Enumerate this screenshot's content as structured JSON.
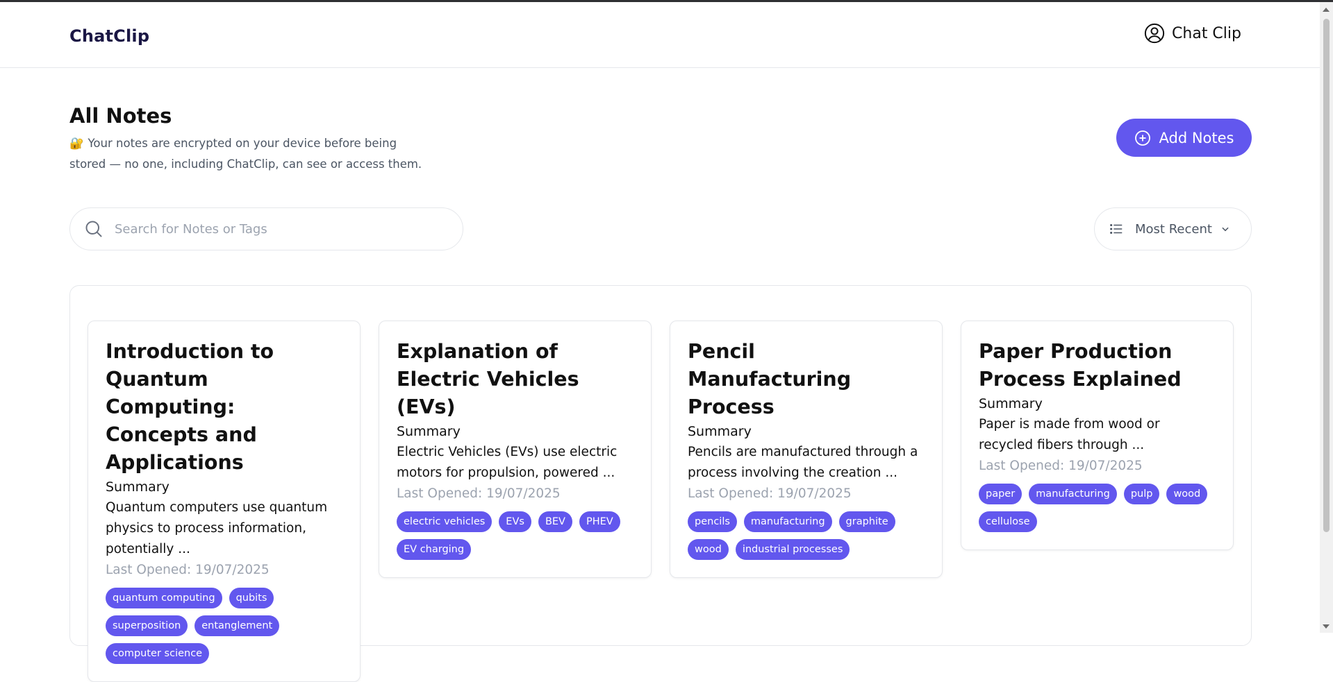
{
  "app": {
    "logo": "ChatClip",
    "user_name": "Chat Clip"
  },
  "page": {
    "title": "All Notes",
    "notice_icon": "🔐",
    "notice_text": "Your notes are encrypted on your device before being stored — no one, including ChatClip, can see or access them.",
    "add_button": "Add Notes"
  },
  "search": {
    "placeholder": "Search for Notes or Tags",
    "value": ""
  },
  "sort": {
    "selected": "Most Recent"
  },
  "notes": [
    {
      "title": "Introduction to Quantum Computing: Concepts and Applications",
      "summary_label": "Summary",
      "summary": "Quantum computers use quantum physics to process information, potentially ...",
      "last_opened": "Last Opened: 19/07/2025",
      "tags": [
        "quantum computing",
        "qubits",
        "superposition",
        "entanglement",
        "computer science"
      ]
    },
    {
      "title": "Explanation of Electric Vehicles (EVs)",
      "summary_label": "Summary",
      "summary": "Electric Vehicles (EVs) use electric motors for propulsion, powered ...",
      "last_opened": "Last Opened: 19/07/2025",
      "tags": [
        "electric vehicles",
        "EVs",
        "BEV",
        "PHEV",
        "EV charging"
      ]
    },
    {
      "title": "Pencil Manufacturing Process",
      "summary_label": "Summary",
      "summary": "Pencils are manufactured through a process involving the creation ...",
      "last_opened": "Last Opened: 19/07/2025",
      "tags": [
        "pencils",
        "manufacturing",
        "graphite",
        "wood",
        "industrial processes"
      ]
    },
    {
      "title": "Paper Production Process Explained",
      "summary_label": "Summary",
      "summary": "Paper is made from wood or recycled fibers through ...",
      "last_opened": "Last Opened: 19/07/2025",
      "tags": [
        "paper",
        "manufacturing",
        "pulp",
        "wood",
        "cellulose"
      ]
    }
  ],
  "colors": {
    "accent": "#6257ee",
    "logo": "#1b1745",
    "muted": "#9ca3af",
    "border": "#e5e7eb"
  }
}
